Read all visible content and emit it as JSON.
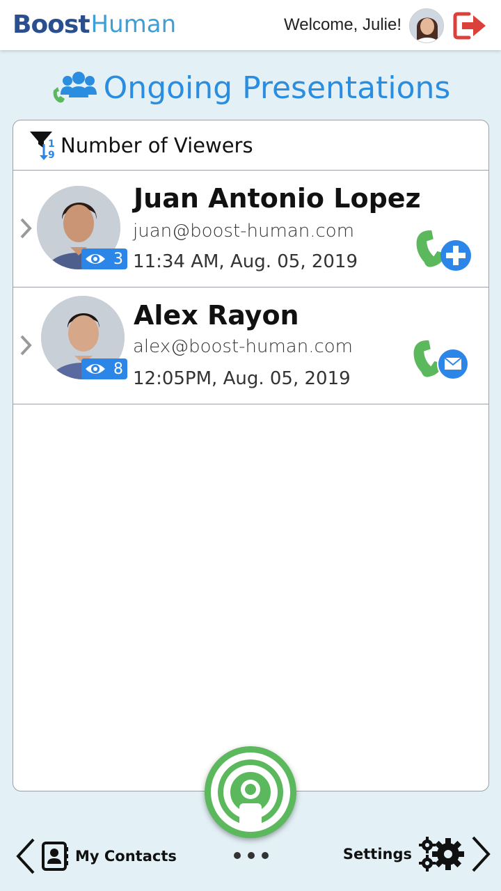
{
  "header": {
    "logo_part1": "Boost",
    "logo_part2": "Human",
    "welcome": "Welcome, Julie!"
  },
  "section": {
    "title": "Ongoing Presentations"
  },
  "sort": {
    "label": "Number of Viewers"
  },
  "presentations": [
    {
      "name": "Juan Antonio Lopez",
      "email": "juan@boost-human.com",
      "time": "11:34 AM, Aug. 05, 2019",
      "viewers": "3",
      "action_icon": "phone-add-icon"
    },
    {
      "name": "Alex Rayon",
      "email": "alex@boost-human.com",
      "time": "12:05PM, Aug. 05, 2019",
      "viewers": "8",
      "action_icon": "phone-mail-icon"
    }
  ],
  "nav": {
    "contacts_label": "My Contacts",
    "settings_label": "Settings"
  },
  "colors": {
    "accent_blue": "#2a8de0",
    "badge_blue": "#2b86e8",
    "green": "#5cb85c",
    "logout_red": "#d9413a",
    "background": "#e3f1f6"
  }
}
